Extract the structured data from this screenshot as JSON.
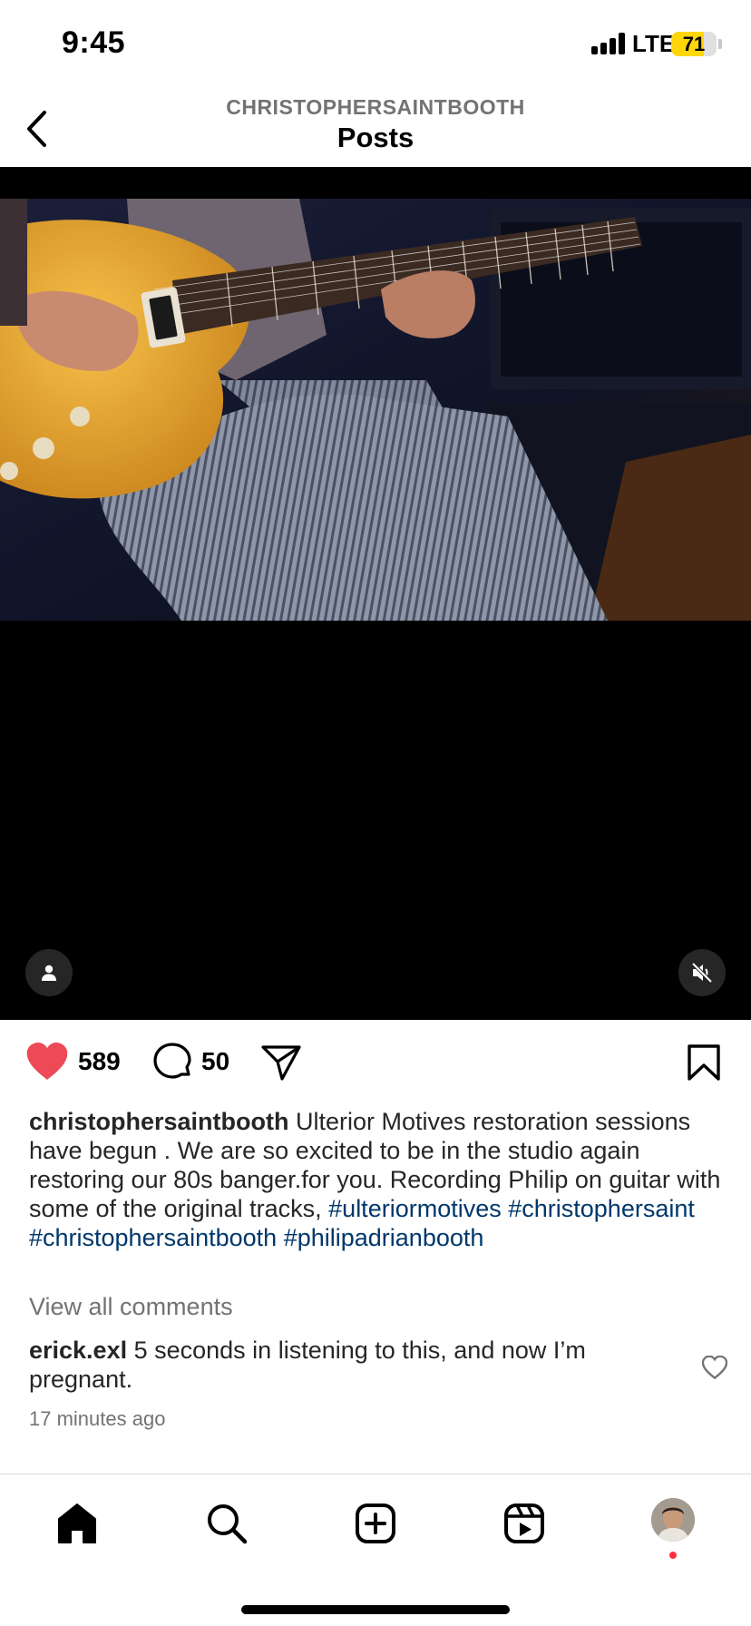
{
  "status_bar": {
    "time": "9:45",
    "network": "LTE",
    "battery_level": 71,
    "battery_color": "#ffd60a"
  },
  "header": {
    "back_icon": "chevron-left-icon",
    "username": "CHRISTOPHERSAINTBOOTH",
    "title": "Posts"
  },
  "media": {
    "type": "video",
    "tag_icon": "person-icon",
    "mute_icon": "speaker-muted-icon"
  },
  "actions": {
    "like_icon": "heart-filled-icon",
    "like_color": "#ed4956",
    "likes": "589",
    "comment_icon": "comment-bubble-icon",
    "comments": "50",
    "share_icon": "paper-plane-icon",
    "save_icon": "bookmark-icon"
  },
  "caption": {
    "username": "christophersaintbooth",
    "text": " Ulterior Motives restoration sessions have begun . We are so excited to be in the studio again restoring our 80s banger.for you. Recording Philip on guitar with some of the original tracks, ",
    "hashtags": [
      "#ulteriormotives",
      "#christophersaint",
      "#christophersaintbooth",
      "#philipadrianbooth"
    ],
    "hashtag_color": "#00376b"
  },
  "comments": {
    "view_all": "View all comments",
    "top_comment": {
      "username": "erick.exl",
      "text": " 5 seconds in listening to this, and now I’m pregnant."
    },
    "timestamp": "17 minutes ago"
  },
  "tab_bar": {
    "items": [
      "home-icon",
      "search-icon",
      "create-post-icon",
      "reels-icon",
      "profile-avatar"
    ],
    "notification_color": "#ff3040"
  }
}
